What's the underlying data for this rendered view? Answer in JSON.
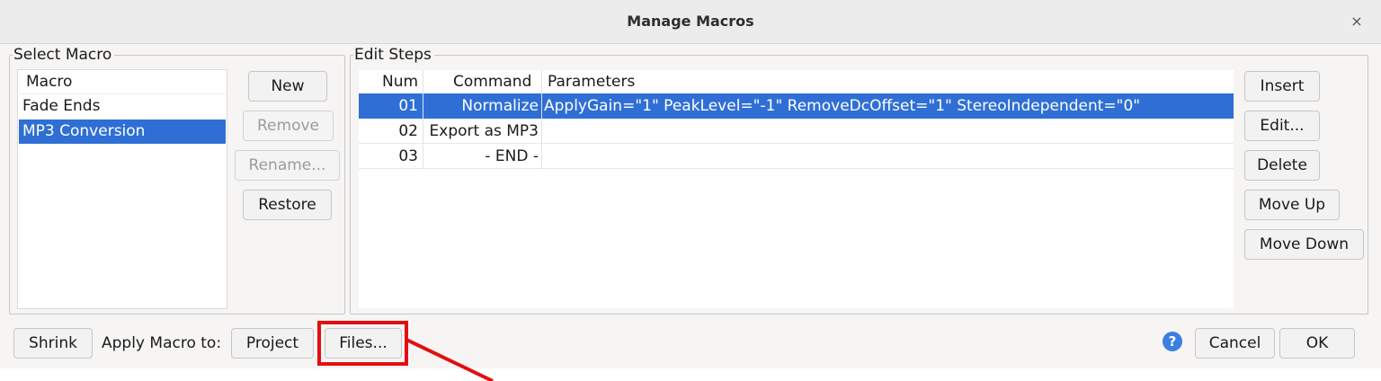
{
  "dialog": {
    "title": "Manage Macros",
    "close_glyph": "×"
  },
  "select_macro": {
    "label": "Select Macro",
    "header": "Macro",
    "items": [
      "Fade Ends",
      "MP3 Conversion"
    ],
    "selected_index": 1
  },
  "macro_buttons": {
    "new": "New",
    "remove": "Remove",
    "rename": "Rename...",
    "restore": "Restore"
  },
  "edit_steps": {
    "label": "Edit Steps",
    "columns": [
      "Num",
      "Command",
      "Parameters"
    ],
    "rows": [
      {
        "num": "01",
        "command": "Normalize",
        "parameters": "ApplyGain=\"1\" PeakLevel=\"-1\" RemoveDcOffset=\"1\" StereoIndependent=\"0\""
      },
      {
        "num": "02",
        "command": "Export as MP3",
        "parameters": ""
      },
      {
        "num": "03",
        "command": "- END -",
        "parameters": ""
      }
    ],
    "selected_row": 0
  },
  "step_buttons": {
    "insert": "Insert",
    "edit": "Edit...",
    "delete": "Delete",
    "move_up": "Move Up",
    "move_down": "Move Down"
  },
  "footer": {
    "shrink": "Shrink",
    "apply_label": "Apply Macro to:",
    "project": "Project",
    "files": "Files...",
    "help_glyph": "?",
    "cancel": "Cancel",
    "ok": "OK"
  },
  "colors": {
    "selection": "#2f6fd5",
    "highlight_annotation": "#e30e10",
    "help_icon": "#3d7fe0"
  },
  "icons": [
    "close-icon",
    "help-icon"
  ]
}
